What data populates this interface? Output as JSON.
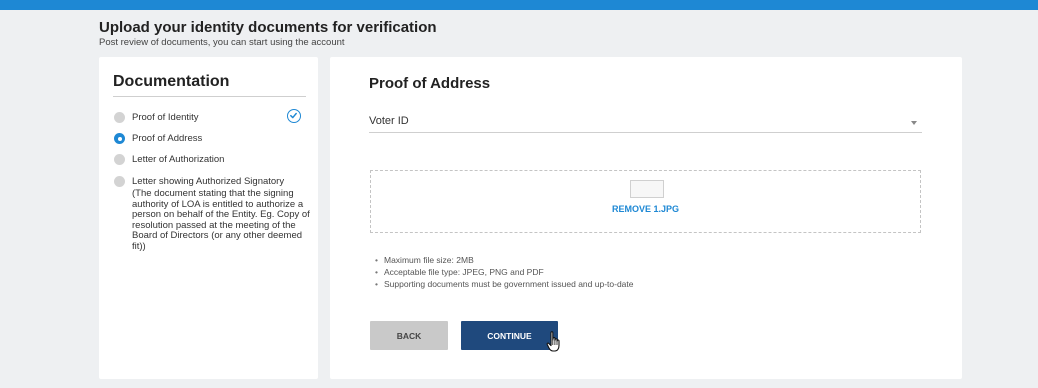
{
  "header": {
    "title": "Upload your identity documents for verification",
    "subtitle": "Post review of documents, you can start using the account"
  },
  "sidebar": {
    "heading": "Documentation",
    "items": [
      {
        "label": "Proof of Identity",
        "state": "completed"
      },
      {
        "label": "Proof of Address",
        "state": "active"
      },
      {
        "label": "Letter of Authorization",
        "state": "pending"
      },
      {
        "label": "Letter showing Authorized Signatory",
        "state": "pending",
        "description": "(The document stating that the signing authority of LOA is entitled to authorize a person on behalf of the Entity. Eg. Copy of resolution passed at the meeting of the Board of Directors (or any other deemed fit))"
      }
    ]
  },
  "main": {
    "heading": "Proof of Address",
    "document_type": {
      "selected": "Voter ID"
    },
    "upload": {
      "remove_label": "REMOVE 1.JPG"
    },
    "rules": [
      "Maximum file size: 2MB",
      "Acceptable file type: JPEG, PNG and PDF",
      "Supporting documents must be government issued and up-to-date"
    ],
    "buttons": {
      "back": "BACK",
      "continue": "CONTINUE"
    }
  },
  "colors": {
    "accent": "#1e88d4",
    "primary_button": "#1f497d",
    "secondary_button": "#c9c9c9",
    "background": "#eef0f2"
  }
}
